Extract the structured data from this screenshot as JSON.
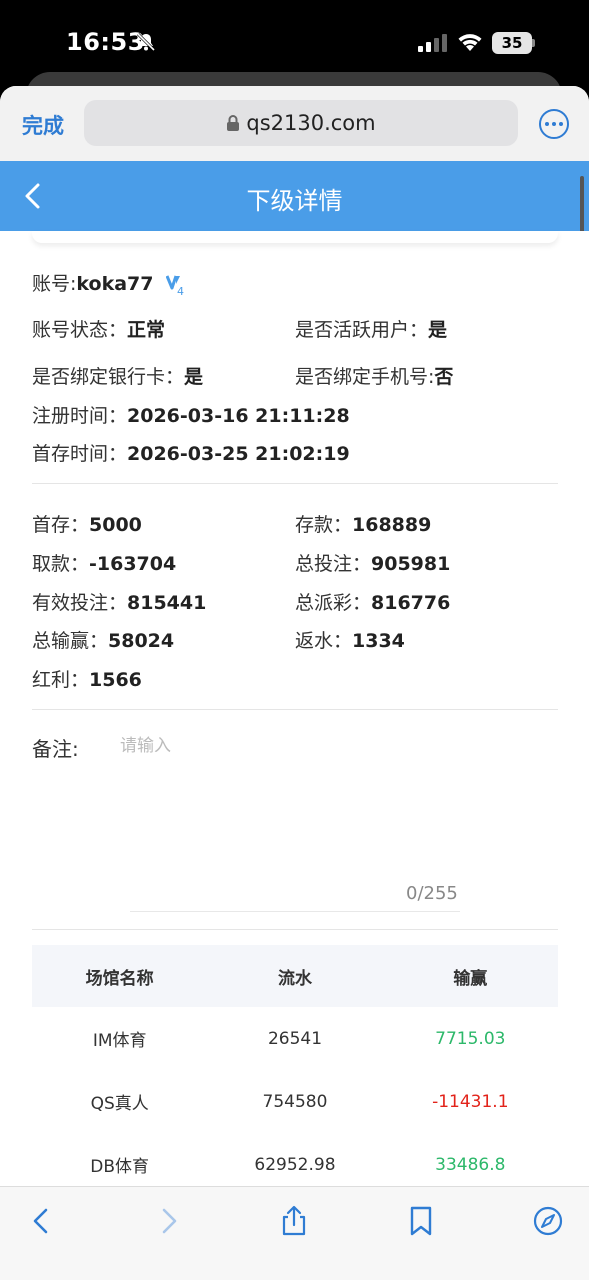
{
  "status": {
    "time": "16:53",
    "battery": "35"
  },
  "browser": {
    "done_label": "完成",
    "url": "qs2130.com"
  },
  "header": {
    "title": "下级详情"
  },
  "account": {
    "label": "账号:",
    "value": "koka77",
    "vip_level": "4",
    "status_label": "账号状态：",
    "status_value": "正常",
    "active_label": "是否活跃用户：",
    "active_value": "是",
    "bank_label": "是否绑定银行卡：",
    "bank_value": "是",
    "phone_label": "是否绑定手机号:",
    "phone_value": "否",
    "reg_label": "注册时间：",
    "reg_value": "2026-03-16 21:11:28",
    "first_dep_label": "首存时间：",
    "first_dep_value": "2026-03-25 21:02:19"
  },
  "stats": {
    "first_deposit_label": "首存：",
    "first_deposit": "5000",
    "deposit_label": "存款：",
    "deposit": "168889",
    "withdraw_label": "取款：",
    "withdraw": "-163704",
    "total_bet_label": "总投注：",
    "total_bet": "905981",
    "valid_bet_label": "有效投注：",
    "valid_bet": "815441",
    "total_payout_label": "总派彩：",
    "total_payout": "816776",
    "total_winloss_label": "总输赢：",
    "total_winloss": "58024",
    "rebate_label": "返水：",
    "rebate": "1334",
    "bonus_label": "红利：",
    "bonus": "1566"
  },
  "remark": {
    "label": "备注:",
    "placeholder": "请输入",
    "counter": "0/255"
  },
  "table": {
    "headers": [
      "场馆名称",
      "流水",
      "输赢"
    ],
    "rows": [
      {
        "venue": "IM体育",
        "turnover": "26541",
        "winloss": "7715.03"
      },
      {
        "venue": "QS真人",
        "turnover": "754580",
        "winloss": "-11431.1"
      },
      {
        "venue": "DB体育",
        "turnover": "62952.98",
        "winloss": "33486.8"
      }
    ]
  },
  "colors": {
    "accent": "#4a9de8",
    "link": "#2f7cd3",
    "positive": "#2db86a",
    "negative": "#e2231a"
  },
  "icons": [
    "bell-slash-icon",
    "signal-icon",
    "wifi-icon",
    "lock-icon",
    "more-icon",
    "back-icon",
    "vip-icon",
    "safari-back-icon",
    "safari-forward-icon",
    "share-icon",
    "bookmark-icon",
    "compass-icon"
  ]
}
